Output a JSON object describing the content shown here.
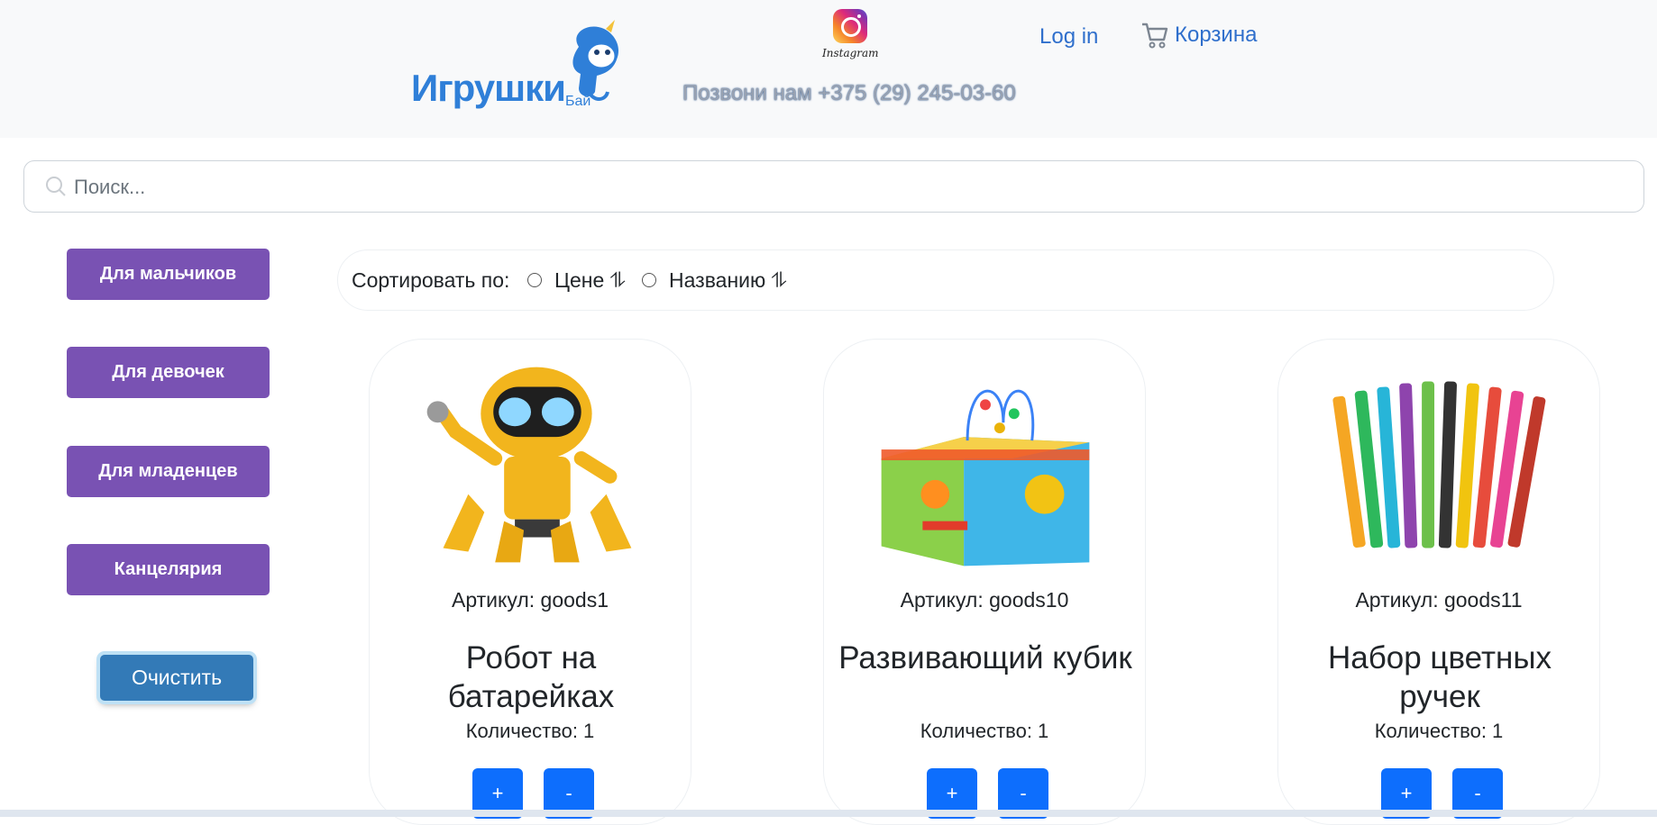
{
  "header": {
    "logo_text": "Игрушки",
    "logo_sub": "Бай",
    "instagram_label": "Instagram",
    "phone": "Позвони нам +375 (29) 245-03-60",
    "login_label": "Log in",
    "cart_label": "Корзина"
  },
  "search": {
    "placeholder": "Поиск..."
  },
  "categories": [
    "Для мальчиков",
    "Для девочек",
    "Для младенцев",
    "Канцелярия"
  ],
  "clear_label": "Очистить",
  "sort": {
    "label": "Сортировать по:",
    "options": [
      "Цене ⥮",
      "Названию ⥮"
    ]
  },
  "products": [
    {
      "sku": "Артикул: goods1",
      "title": "Робот на батарейках",
      "qty": "Количество: 1",
      "plus": "+",
      "minus": "-"
    },
    {
      "sku": "Артикул: goods10",
      "title": "Развивающий кубик",
      "qty": "Количество: 1",
      "plus": "+",
      "minus": "-"
    },
    {
      "sku": "Артикул: goods11",
      "title": "Набор цветных ручек",
      "qty": "Количество: 1",
      "plus": "+",
      "minus": "-"
    }
  ],
  "colors": {
    "category_button": "#7952b3",
    "clear_button": "#337ab7",
    "qty_button": "#0d6efd",
    "link": "#2f6fcc"
  }
}
